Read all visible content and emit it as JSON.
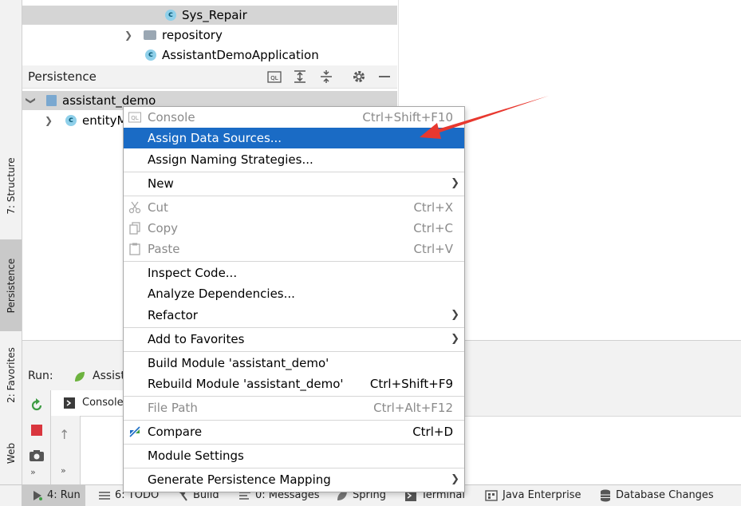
{
  "colors": {
    "accent": "#1a6bc5",
    "arrow": "#e8382f",
    "selection": "#d5d5d5"
  },
  "tree": {
    "items": [
      {
        "label": "Sys_Repair",
        "icon": "class-icon"
      },
      {
        "label": "repository",
        "icon": "folder-icon"
      },
      {
        "label": "AssistantDemoApplication",
        "icon": "spring-class-icon"
      }
    ]
  },
  "persistence": {
    "title": "Persistence",
    "root": "assistant_demo",
    "child": "entityM",
    "header_buttons": [
      "ql-icon",
      "expand-all-icon",
      "collapse-all-icon",
      "gear-icon",
      "minimize-icon"
    ]
  },
  "left_strip": {
    "structure": "7: Structure",
    "persistence": "Persistence",
    "favorites": "2: Favorites",
    "web": "Web"
  },
  "run": {
    "label": "Run:",
    "tab": "Assist",
    "console_tab": "Console"
  },
  "menu": {
    "items": [
      {
        "label": "Console",
        "shortcut": "Ctrl+Shift+F10",
        "disabled": true,
        "icon": "ql-icon"
      },
      {
        "label": "Assign Data Sources...",
        "highlighted": true
      },
      {
        "label": "Assign Naming Strategies..."
      },
      {
        "label": "New",
        "submenu": true
      },
      {
        "label": "Cut",
        "shortcut": "Ctrl+X",
        "disabled": true,
        "icon": "scissors-icon"
      },
      {
        "label": "Copy",
        "shortcut": "Ctrl+C",
        "disabled": true,
        "icon": "copy-icon"
      },
      {
        "label": "Paste",
        "shortcut": "Ctrl+V",
        "disabled": true,
        "icon": "paste-icon"
      },
      {
        "label": "Inspect Code..."
      },
      {
        "label": "Analyze Dependencies..."
      },
      {
        "label": "Refactor",
        "submenu": true
      },
      {
        "label": "Add to Favorites",
        "submenu": true
      },
      {
        "label": "Build Module 'assistant_demo'"
      },
      {
        "label": "Rebuild Module 'assistant_demo'",
        "shortcut": "Ctrl+Shift+F9"
      },
      {
        "label": "File Path",
        "shortcut": "Ctrl+Alt+F12",
        "disabled": true
      },
      {
        "label": "Compare",
        "shortcut": "Ctrl+D",
        "icon": "compare-icon"
      },
      {
        "label": "Module Settings"
      },
      {
        "label": "Generate Persistence Mapping",
        "submenu": true
      }
    ]
  },
  "bottom_bar": [
    {
      "label": "4: Run",
      "icon": "run-icon",
      "active": true
    },
    {
      "label": "6: TODO",
      "icon": "todo-icon"
    },
    {
      "label": "Build",
      "icon": "hammer-icon"
    },
    {
      "label": "0: Messages",
      "icon": "messages-icon"
    },
    {
      "label": "Spring",
      "icon": "spring-leaf-icon"
    },
    {
      "label": "Terminal",
      "icon": "terminal-icon"
    },
    {
      "label": "Java Enterprise",
      "icon": "java-enterprise-icon"
    },
    {
      "label": "Database Changes",
      "icon": "database-icon"
    }
  ]
}
